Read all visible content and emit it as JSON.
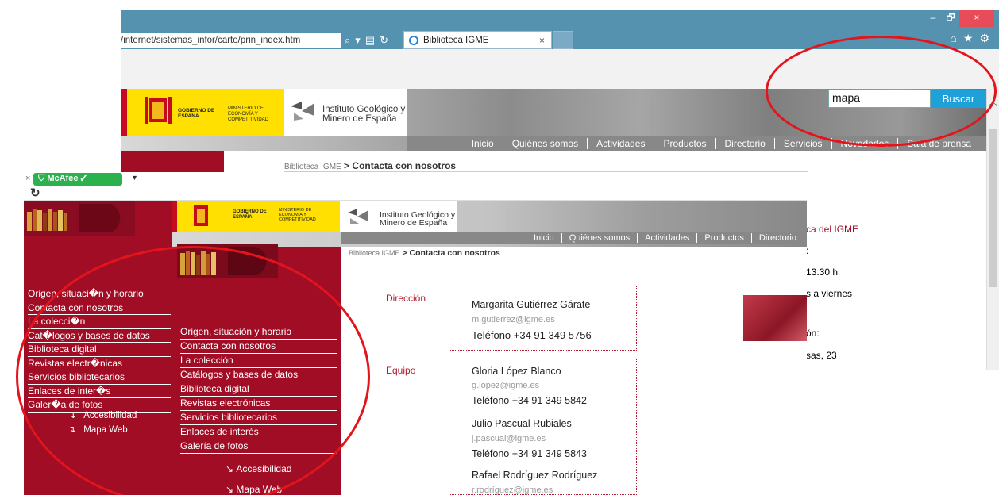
{
  "back_browser": {
    "address": "/internet/sistemas_infor/carto/prin_index.htm",
    "tab_title": "Biblioteca IGME",
    "tab_close": "×",
    "window_min": "–",
    "window_restore": "🗗",
    "window_close": "×",
    "gobierno": "GOBIERNO DE ESPAÑA",
    "ministerio": "MINISTERIO DE ECONOMÍA Y COMPETITIVIDAD",
    "institute": "Instituto Geológico y Minero de España",
    "menu": [
      "Inicio",
      "Quiénes somos",
      "Actividades",
      "Productos",
      "Directorio",
      "Servicios",
      "Novedades",
      "Sala de prensa"
    ],
    "search_value": "mapa",
    "search_button": "Buscar",
    "breadcrumb_root": "Biblioteca IGME",
    "breadcrumb_sep": ">",
    "breadcrumb_current": "Contacta con nosotros",
    "right_text": {
      "library": "ca del IGME",
      "colon": ":",
      "hours": "13.30 h",
      "days": "s a viernes",
      "address_label": "ón:",
      "street": "sas, 23"
    }
  },
  "front_browser": {
    "mcafee": "McAfee",
    "gobierno": "GOBIERNO DE ESPAÑA",
    "ministerio": "MINISTERIO DE ECONOMÍA Y COMPETITIVIDAD",
    "institute": "Instituto Geológico y Minero de España",
    "menu": [
      "Inicio",
      "Quiénes somos",
      "Actividades",
      "Productos",
      "Directorio"
    ],
    "nav_garbled": [
      "Origen, situaci�n y horario",
      "Contacta con nosotros",
      "La colecci�n",
      "Cat�logos y bases de datos",
      "Biblioteca digital",
      "Revistas electr�nicas",
      "Servicios bibliotecarios",
      "Enlaces de inter�s",
      "Galer�a de fotos"
    ],
    "nav_garbled_footer": [
      "Accesibilidad",
      "Mapa Web"
    ],
    "nav": [
      "Origen, situación y horario",
      "Contacta con nosotros",
      "La colección",
      "Catálogos y bases de datos",
      "Biblioteca digital",
      "Revistas electrónicas",
      "Servicios bibliotecarios",
      "Enlaces de interés",
      "Galería de fotos"
    ],
    "nav_footer": [
      "Accesibilidad",
      "Mapa Web"
    ],
    "breadcrumb_root": "Biblioteca IGME",
    "breadcrumb_sep": ">",
    "breadcrumb_current": "Contacta con nosotros",
    "direccion_label": "Dirección",
    "equipo_label": "Equipo",
    "director": {
      "name": "Margarita Gutiérrez Gárate",
      "email": "m.gutierrez@igme.es",
      "phone": "Teléfono +34 91 349 5756"
    },
    "team": [
      {
        "name": "Gloria López Blanco",
        "email": "g.lopez@igme.es",
        "phone": "Teléfono +34 91 349 5842"
      },
      {
        "name": "Julio Pascual Rubiales",
        "email": "j.pascual@igme.es",
        "phone": "Teléfono +34 91 349 5843"
      },
      {
        "name": "Rafael Rodríguez Rodríguez",
        "email": "r.rodríguez@igme.es"
      }
    ]
  },
  "colors": {
    "highlight": "#e3141b",
    "sidebar_red": "#a00d25",
    "browser_chrome": "#5592b0",
    "search_button": "#1ea1d8"
  }
}
